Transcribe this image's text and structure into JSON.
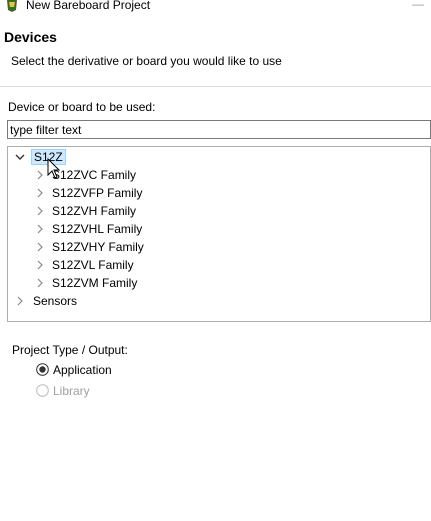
{
  "window": {
    "title": "New Bareboard Project"
  },
  "header": {
    "title": "Devices",
    "description": "Select the derivative or board you would like to use"
  },
  "device": {
    "label": "Device or board to be used:",
    "filter_value": "type filter text"
  },
  "tree": {
    "root": {
      "label": "S12Z",
      "expanded": true,
      "selected": true
    },
    "children": [
      {
        "label": "S12ZVC Family"
      },
      {
        "label": "S12ZVFP Family"
      },
      {
        "label": "S12ZVH Family"
      },
      {
        "label": "S12ZVHL Family"
      },
      {
        "label": "S12ZVHY Family"
      },
      {
        "label": "S12ZVL Family"
      },
      {
        "label": "S12ZVM Family"
      }
    ],
    "sibling": {
      "label": "Sensors",
      "expanded": false
    }
  },
  "project_type": {
    "label": "Project Type / Output:",
    "options": [
      {
        "label": "Application",
        "selected": true,
        "enabled": true
      },
      {
        "label": "Library",
        "selected": false,
        "enabled": false
      }
    ]
  },
  "colors": {
    "selection_fill": "#cce8ff",
    "selection_border": "#99d1ff",
    "disabled_text": "#a0a0a0"
  }
}
